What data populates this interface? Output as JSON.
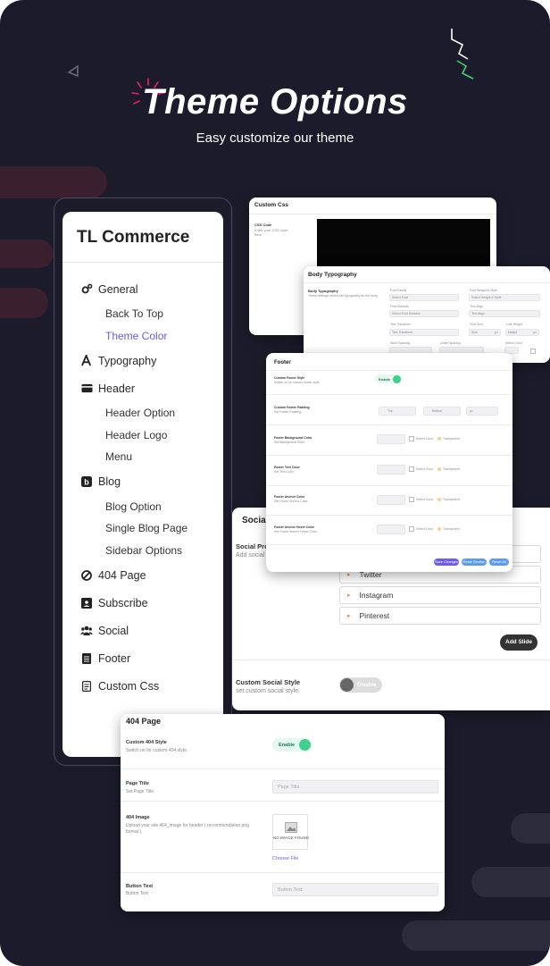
{
  "hero": {
    "title": "Theme Options",
    "subtitle": "Easy customize our theme"
  },
  "sidebar": {
    "brand": "TL Commerce",
    "items": [
      {
        "label": "General",
        "icon": "gears-icon",
        "children": [
          "Back To Top",
          "Theme Color"
        ]
      },
      {
        "label": "Typography",
        "icon": "font-icon",
        "children": []
      },
      {
        "label": "Header",
        "icon": "credit-card-icon",
        "children": [
          "Header Option",
          "Header Logo",
          "Menu"
        ]
      },
      {
        "label": "Blog",
        "icon": "blogger-icon",
        "children": [
          "Blog Option",
          "Single Blog Page",
          "Sidebar Options"
        ]
      },
      {
        "label": "404 Page",
        "icon": "ban-icon",
        "children": []
      },
      {
        "label": "Subscribe",
        "icon": "address-card-icon",
        "children": []
      },
      {
        "label": "Social",
        "icon": "users-icon",
        "children": []
      },
      {
        "label": "Footer",
        "icon": "file-icon",
        "children": []
      },
      {
        "label": "Custom Css",
        "icon": "file-text-icon",
        "children": []
      }
    ],
    "active_child": "Theme Color"
  },
  "custom_css": {
    "title": "Custom Css",
    "field_label": "CSS Code",
    "field_desc": "Enter your CSS code here."
  },
  "typography": {
    "title": "Body Typography",
    "label": "Body Typography",
    "desc": "These settings control the typography for the body.",
    "fields": [
      {
        "label": "Font Family",
        "value": "Select Font"
      },
      {
        "label": "Font Weight & Style",
        "value": "Select Weight & Style"
      },
      {
        "label": "Font Subsets",
        "value": "Select Font Subsets"
      },
      {
        "label": "Text Align",
        "value": "Text Align"
      },
      {
        "label": "Text Transform",
        "value": "Text Transform"
      },
      {
        "label": "Font Size",
        "value": "Size",
        "unit": "px"
      },
      {
        "label": "Line Height",
        "value": "Height",
        "unit": "px"
      },
      {
        "label": "Word Spacing",
        "value": ""
      },
      {
        "label": "Letter Spacing",
        "value": ""
      },
      {
        "label": "Select Color",
        "value": ""
      }
    ]
  },
  "footer": {
    "title": "Footer",
    "rows": [
      {
        "label": "Custom Footer Style",
        "desc": "Switch on for custom footer style.",
        "toggle": "Enable"
      },
      {
        "label": "Custom Footer Padding",
        "desc": "Set Footer Padding.",
        "top": "Top",
        "bottom": "Bottom",
        "unit": "px"
      },
      {
        "label": "Footer Background Color",
        "desc": "Set Background Color",
        "select": "Select Color",
        "transparent": "Transparent"
      },
      {
        "label": "Footer Text Color",
        "desc": "Set Text Color",
        "select": "Select Color",
        "transparent": "Transparent"
      },
      {
        "label": "Footer Anchor Color",
        "desc": "Set Footer Anchor Color",
        "select": "Select Color",
        "transparent": "Transparent"
      },
      {
        "label": "Footer Anchor Hover Color",
        "desc": "Set Footer Anchor Hover Color",
        "select": "Select Color",
        "transparent": "Transparent"
      }
    ],
    "buttons": [
      "Save Changes",
      "Reset Section",
      "Reset All"
    ]
  },
  "social": {
    "title": "Social",
    "profile_label": "Social Pro",
    "profile_desc": "Add social",
    "links": [
      "Twitter",
      "Instagram",
      "Pinterest"
    ],
    "add_button": "Add Slide",
    "style_label": "Custom Social Style",
    "style_desc": "set custom social style.",
    "style_toggle": "Disable"
  },
  "page404": {
    "title": "404 Page",
    "style_label": "Custom 404 Style",
    "style_desc": "Switch on for custom 404 style.",
    "style_toggle": "Enable",
    "page_title_label": "Page Title",
    "page_title_desc": "Set Page Title",
    "page_title_placeholder": "Page Title",
    "image_label": "404 Image",
    "image_desc": "Upload your site 404_image for header ( recommendation png format ).",
    "no_image": "NO IMAGE FOUND",
    "choose_file": "Choose File",
    "button_label": "Button Text",
    "button_desc": "Button Text",
    "button_placeholder": "Button Text"
  },
  "colors": {
    "bg": "#1c1b2b",
    "accent": "#6c5ce7",
    "toggle": "#3fcf8e",
    "save": "#6c5ce7",
    "reset": "#5b9cf0"
  }
}
